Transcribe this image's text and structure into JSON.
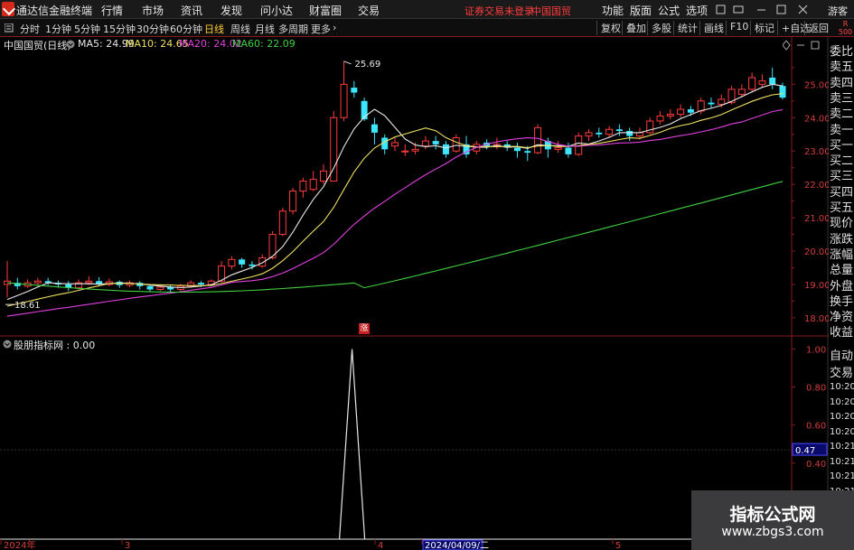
{
  "menubar": {
    "app_title": "通达信金融终端",
    "items": [
      "行情",
      "市场",
      "资讯",
      "发现",
      "问小达",
      "财富圈",
      "交易"
    ],
    "status_text": "证券交易未登录",
    "stock_name": "中国国贸",
    "right_items": [
      "功能",
      "版面",
      "公式",
      "选项"
    ],
    "guest_label": "游客"
  },
  "toolbar": {
    "periods": [
      "分时",
      "1分钟",
      "5分钟",
      "15分钟",
      "30分钟",
      "60分钟",
      "日线",
      "周线",
      "月线",
      "多周期",
      "更多"
    ],
    "active_period": "日线",
    "right_buttons": [
      "复权",
      "叠加",
      "多股",
      "统计",
      "画线",
      "F10",
      "标记",
      "+自选",
      "返回"
    ]
  },
  "badge": {
    "line1": "R",
    "line2": "500"
  },
  "main_chart": {
    "title": "中国国贸(日线)",
    "ma_labels": [
      {
        "text": "MA5: 24.99",
        "color": "#e8e8e8"
      },
      {
        "text": "MA10: 24.65",
        "color": "#f0e060"
      },
      {
        "text": "MA20: 24.02",
        "color": "#e040e0"
      },
      {
        "text": "MA60: 22.09",
        "color": "#40d040"
      }
    ],
    "price_ticks": [
      "25.00",
      "24.00",
      "23.00",
      "22.00",
      "21.00",
      "20.00",
      "19.00",
      "18.00"
    ],
    "high_annotation": "25.69",
    "low_annotation": "18.61",
    "limit_up_marker": "涨"
  },
  "sub_chart": {
    "title": "股朋指标网 : 0.00",
    "ticks": [
      "1.00",
      "0.80",
      "0.60",
      "0.40"
    ],
    "cursor_value": "0.47"
  },
  "x_axis": {
    "labels": [
      "2024年",
      "3",
      "4",
      "2024/04/09/二",
      "5"
    ]
  },
  "side_panel": {
    "items": [
      "委比",
      "卖五",
      "卖四",
      "卖三",
      "卖二",
      "卖一",
      "买一",
      "买二",
      "买三",
      "买四",
      "买五",
      "现价",
      "涨跌",
      "涨幅",
      "总量",
      "外盘",
      "换手",
      "净资",
      "收益"
    ],
    "lower_items": [
      "自动",
      "交易"
    ],
    "times": [
      "10:20",
      "10:20",
      "10:20",
      "10:20",
      "10:21",
      "10:21",
      "10:21",
      "10:21"
    ]
  },
  "watermark": {
    "line1": "指标公式网",
    "line2": "www.zbgs3.com"
  },
  "colors": {
    "up": "#ff3c3c",
    "down": "#3ce6ff",
    "ma5": "#e8e8e8",
    "ma10": "#f0e060",
    "ma20": "#e040e0",
    "ma60": "#40d040",
    "grid": "#8a1a1a"
  },
  "chart_data": {
    "type": "candlestick",
    "title": "中国国贸(日线)",
    "ylim": [
      17.7,
      26.2
    ],
    "candles": [
      [
        19.0,
        19.1,
        19.7,
        18.61
      ],
      [
        19.05,
        18.95,
        19.2,
        18.85
      ],
      [
        18.95,
        19.05,
        19.15,
        18.9
      ],
      [
        19.05,
        19.1,
        19.2,
        18.95
      ],
      [
        19.1,
        19.05,
        19.2,
        18.98
      ],
      [
        19.05,
        19.0,
        19.12,
        18.9
      ],
      [
        19.0,
        18.9,
        19.1,
        18.8
      ],
      [
        18.9,
        19.05,
        19.15,
        18.85
      ],
      [
        19.05,
        19.1,
        19.25,
        18.98
      ],
      [
        19.1,
        19.0,
        19.22,
        18.95
      ],
      [
        19.0,
        19.08,
        19.18,
        18.95
      ],
      [
        19.08,
        18.98,
        19.12,
        18.9
      ],
      [
        18.98,
        19.05,
        19.12,
        18.92
      ],
      [
        19.05,
        18.95,
        19.1,
        18.85
      ],
      [
        18.95,
        18.85,
        19.0,
        18.78
      ],
      [
        18.85,
        18.92,
        19.0,
        18.8
      ],
      [
        18.92,
        18.85,
        18.98,
        18.76
      ],
      [
        18.85,
        18.95,
        19.02,
        18.8
      ],
      [
        18.95,
        19.05,
        19.12,
        18.9
      ],
      [
        19.05,
        19.0,
        19.1,
        18.92
      ],
      [
        19.0,
        19.1,
        19.15,
        18.95
      ],
      [
        19.1,
        19.55,
        19.7,
        19.05
      ],
      [
        19.55,
        19.75,
        19.85,
        19.45
      ],
      [
        19.75,
        19.6,
        19.8,
        19.5
      ],
      [
        19.6,
        19.55,
        19.7,
        19.45
      ],
      [
        19.55,
        19.8,
        19.9,
        19.5
      ],
      [
        19.8,
        20.5,
        20.6,
        19.75
      ],
      [
        20.5,
        21.2,
        21.3,
        20.45
      ],
      [
        21.2,
        21.8,
        21.9,
        21.1
      ],
      [
        21.8,
        22.1,
        22.2,
        21.6
      ],
      [
        21.85,
        22.15,
        22.4,
        21.8
      ],
      [
        22.1,
        22.4,
        22.6,
        22.0
      ],
      [
        22.1,
        24.0,
        24.2,
        22.1
      ],
      [
        24.0,
        25.0,
        25.69,
        23.9
      ],
      [
        24.9,
        24.75,
        25.1,
        24.6
      ],
      [
        24.5,
        23.95,
        24.6,
        23.9
      ],
      [
        23.8,
        23.55,
        24.0,
        23.2
      ],
      [
        23.4,
        23.05,
        23.5,
        22.9
      ],
      [
        23.15,
        23.25,
        23.4,
        23.0
      ],
      [
        23.0,
        23.0,
        23.2,
        22.85
      ],
      [
        23.0,
        23.05,
        23.25,
        22.9
      ],
      [
        23.15,
        23.3,
        23.45,
        23.05
      ],
      [
        23.3,
        23.2,
        23.45,
        23.05
      ],
      [
        23.2,
        22.9,
        23.3,
        22.8
      ],
      [
        23.0,
        23.4,
        23.5,
        22.95
      ],
      [
        23.2,
        22.9,
        23.45,
        22.8
      ],
      [
        23.0,
        23.2,
        23.3,
        22.9
      ],
      [
        23.25,
        23.15,
        23.35,
        23.05
      ],
      [
        23.15,
        23.2,
        23.4,
        23.05
      ],
      [
        23.2,
        23.1,
        23.3,
        23.0
      ],
      [
        23.1,
        23.0,
        23.25,
        22.8
      ],
      [
        23.0,
        22.95,
        23.15,
        22.7
      ],
      [
        22.95,
        23.7,
        23.8,
        22.9
      ],
      [
        23.3,
        23.05,
        23.4,
        22.8
      ],
      [
        23.05,
        23.1,
        23.3,
        22.95
      ],
      [
        23.1,
        22.9,
        23.25,
        22.8
      ],
      [
        22.9,
        23.45,
        23.55,
        22.85
      ],
      [
        23.45,
        23.55,
        23.65,
        23.3
      ],
      [
        23.55,
        23.5,
        23.7,
        23.4
      ],
      [
        23.5,
        23.65,
        23.75,
        23.4
      ],
      [
        23.65,
        23.6,
        23.8,
        23.45
      ],
      [
        23.6,
        23.45,
        23.7,
        23.3
      ],
      [
        23.45,
        23.55,
        23.7,
        23.35
      ],
      [
        23.55,
        23.9,
        24.0,
        23.5
      ],
      [
        23.9,
        24.05,
        24.2,
        23.8
      ],
      [
        24.05,
        24.1,
        24.25,
        23.95
      ],
      [
        24.1,
        24.25,
        24.4,
        24.0
      ],
      [
        24.25,
        24.15,
        24.35,
        24.05
      ],
      [
        24.2,
        24.5,
        24.6,
        24.1
      ],
      [
        24.45,
        24.4,
        24.6,
        24.3
      ],
      [
        24.4,
        24.55,
        24.7,
        24.3
      ],
      [
        24.45,
        24.85,
        24.95,
        24.4
      ],
      [
        24.7,
        24.85,
        25.0,
        24.6
      ],
      [
        24.85,
        25.2,
        25.35,
        24.75
      ],
      [
        25.0,
        25.1,
        25.3,
        24.9
      ],
      [
        25.2,
        25.0,
        25.5,
        24.85
      ],
      [
        24.95,
        24.6,
        25.05,
        24.55
      ]
    ],
    "sub_indicator": {
      "name": "股朋指标网",
      "spike_value": 1.0,
      "baseline": 0.0,
      "ylim": [
        0,
        1.05
      ]
    }
  }
}
